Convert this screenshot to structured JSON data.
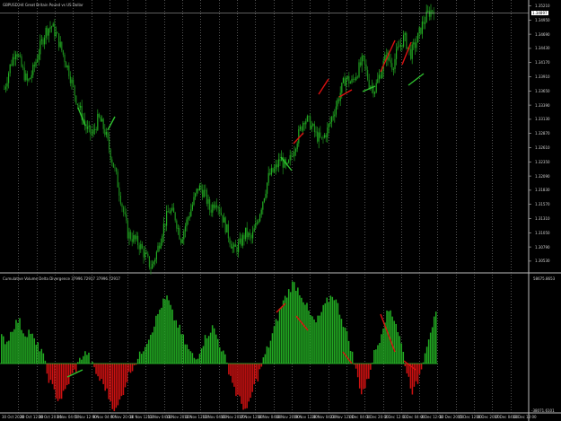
{
  "main_panel": {
    "title": "GBPUSD,H4  Great Britain Pound vs US Dollar",
    "price_scale": [
      "1.35210",
      "1.34950",
      "1.34690",
      "1.34430",
      "1.34170",
      "1.33910",
      "1.33650",
      "1.33390",
      "1.33130",
      "1.32870",
      "1.32610",
      "1.32350",
      "1.32090",
      "1.31830",
      "1.31570",
      "1.31310",
      "1.31050",
      "1.30790",
      "1.30530"
    ],
    "current_price": "1.34897"
  },
  "indicator_panel": {
    "title": "Cumulative Volume Delta Divergence  37996.72917  37996.72917",
    "scale_top": "58675.8653",
    "scale_bottom": "-38071.6101"
  },
  "time_axis": [
    "30 Oct 2020",
    "30 Oct 12:00",
    "30 Oct 20:00",
    "3 Nov 04:00",
    "5 Nov 12:00",
    "9 Nov 04:00",
    "9 Nov 20:00",
    "10 Nov 12:00",
    "11 Nov 04:00",
    "11 Nov 20:00",
    "12 Nov 12:00",
    "13 Nov 04:00",
    "16 Nov 20:00",
    "17 Nov 12:00",
    "18 Nov 04:00",
    "18 Nov 20:00",
    "19 Nov 12:00",
    "20 Nov 04:00",
    "23 Nov 12:00",
    "1 Dec 04:00",
    "1 Dec 20:00",
    "2 Dec 12:00",
    "3 Dec 04:00",
    "4 Dec 12:00",
    "10 Dec 20:00",
    "15 Dec 12:00",
    "16 Dec 20:00",
    "17 Dec 04:00",
    "18 Dec 12:00"
  ],
  "colors": {
    "background": "#000000",
    "bull_candle": "#22aa22",
    "bear_candle": "#1c8c1c",
    "divergence_bear": "#dd1111",
    "divergence_bull": "#2fc22f",
    "histogram_pos": "#22aa22",
    "histogram_neg": "#cc1111",
    "grid": "#8a8a8a",
    "text": "#d0d0d0"
  },
  "chart_data": {
    "type": "candlestick",
    "symbol": "GBPUSD",
    "timeframe": "H4",
    "ylim": [
      1.3053,
      1.3521
    ],
    "close_path": [
      1.337,
      1.341,
      1.344,
      1.3405,
      1.338,
      1.3405,
      1.344,
      1.347,
      1.348,
      1.346,
      1.343,
      1.34,
      1.336,
      1.333,
      1.33,
      1.329,
      1.332,
      1.33,
      1.326,
      1.322,
      1.317,
      1.312,
      1.311,
      1.31,
      1.308,
      1.306,
      1.309,
      1.313,
      1.316,
      1.315,
      1.311,
      1.314,
      1.317,
      1.32,
      1.319,
      1.316,
      1.318,
      1.315,
      1.312,
      1.309,
      1.31,
      1.312,
      1.311,
      1.314,
      1.318,
      1.322,
      1.323,
      1.325,
      1.323,
      1.326,
      1.329,
      1.332,
      1.331,
      1.329,
      1.328,
      1.33,
      1.333,
      1.336,
      1.339,
      1.338,
      1.34,
      1.342,
      1.338,
      1.337,
      1.34,
      1.343,
      1.341,
      1.344,
      1.346,
      1.343,
      1.345,
      1.348,
      1.35,
      1.351
    ],
    "cvd_histogram": [
      14000,
      12000,
      20000,
      24000,
      16000,
      18000,
      10000,
      8000,
      -6000,
      -14000,
      -20000,
      -16000,
      -8000,
      -3000,
      4000,
      6000,
      -2000,
      -8000,
      -12000,
      -20000,
      -26000,
      -18000,
      -8000,
      -1000,
      3000,
      10000,
      16000,
      24000,
      32000,
      36000,
      26000,
      20000,
      12000,
      6000,
      2000,
      10000,
      16000,
      20000,
      12000,
      4000,
      -6000,
      -16000,
      -22000,
      -26000,
      -14000,
      -6000,
      4000,
      12000,
      22000,
      32000,
      38000,
      44000,
      40000,
      34000,
      26000,
      22000,
      28000,
      34000,
      38000,
      30000,
      20000,
      10000,
      -4000,
      -16000,
      -10000,
      4000,
      12000,
      24000,
      30000,
      22000,
      10000,
      -6000,
      -16000,
      -8000,
      6000,
      18000,
      26000
    ]
  }
}
